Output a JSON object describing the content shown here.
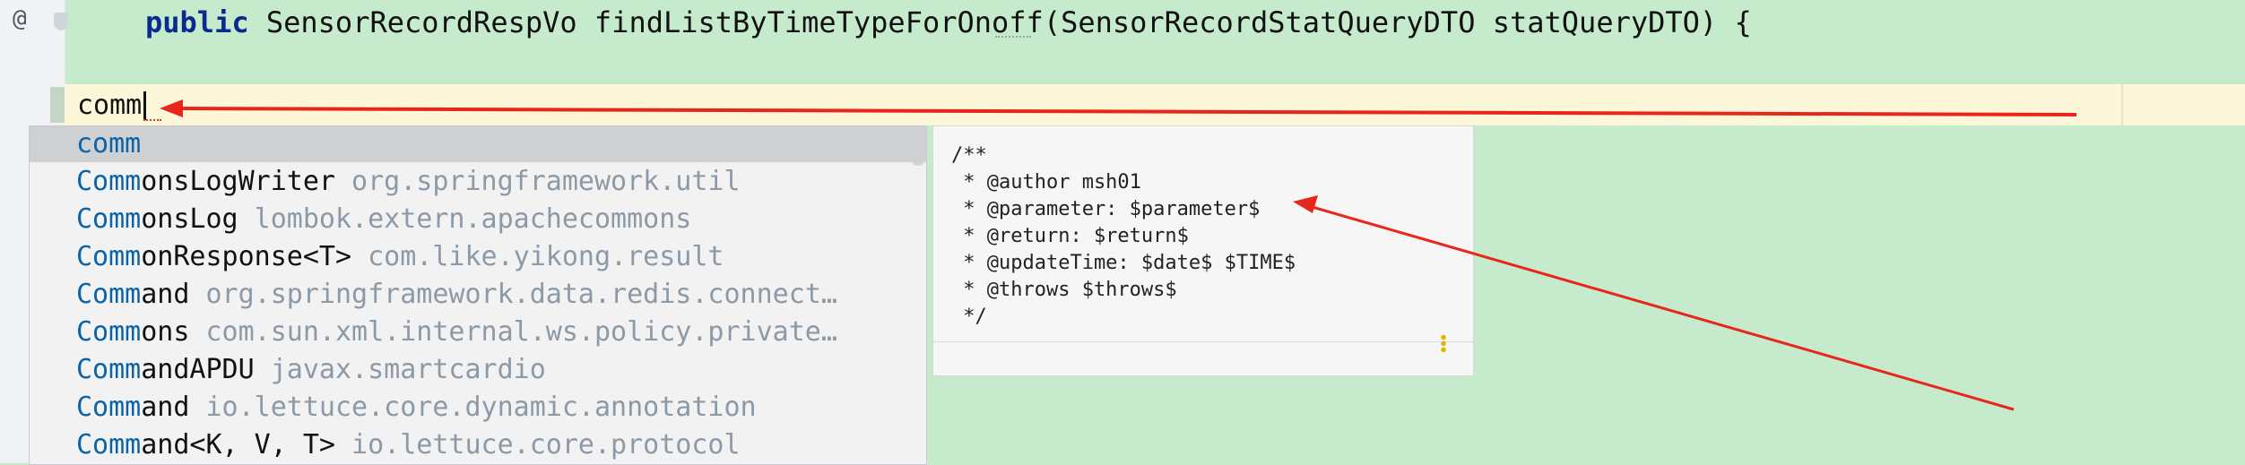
{
  "gutter": {
    "at_symbol": "@"
  },
  "code": {
    "signature_keyword": "public",
    "signature_rest": " SensorRecordRespVo findListByTimeTypeForOnoff(SensorRecordStatQueryDTO statQueryDTO) {",
    "typed_text": "comm"
  },
  "completion": {
    "items": [
      {
        "match": "comm",
        "rest": "",
        "detail": ""
      },
      {
        "match": "Comm",
        "rest": "onsLogWriter",
        "detail": " org.springframework.util"
      },
      {
        "match": "Comm",
        "rest": "onsLog",
        "detail": " lombok.extern.apachecommons"
      },
      {
        "match": "Comm",
        "rest": "onResponse<T>",
        "detail": " com.like.yikong.result"
      },
      {
        "match": "Comm",
        "rest": "and",
        "detail": " org.springframework.data.redis.connect…"
      },
      {
        "match": "Comm",
        "rest": "ons",
        "detail": " com.sun.xml.internal.ws.policy.private…"
      },
      {
        "match": "Comm",
        "rest": "andAPDU",
        "detail": " javax.smartcardio"
      },
      {
        "match": "Comm",
        "rest": "and",
        "detail": " io.lettuce.core.dynamic.annotation"
      },
      {
        "match": "Comm",
        "rest": "and<K, V, T>",
        "detail": " io.lettuce.core.protocol"
      }
    ]
  },
  "preview": {
    "text": "/**\n * @author msh01\n * @parameter: $parameter$\n * @return: $return$\n * @updateTime: $date$ $TIME$\n * @throws $throws$\n */"
  },
  "colors": {
    "editor_bg": "#c6ebcc",
    "current_line": "#fbf7d8",
    "match_blue": "#0a63a8",
    "arrow_red": "#e8261c"
  },
  "icons": [
    "at-sign-icon",
    "shield-icon",
    "kebab-menu-icon",
    "red-arrow-annotation"
  ]
}
